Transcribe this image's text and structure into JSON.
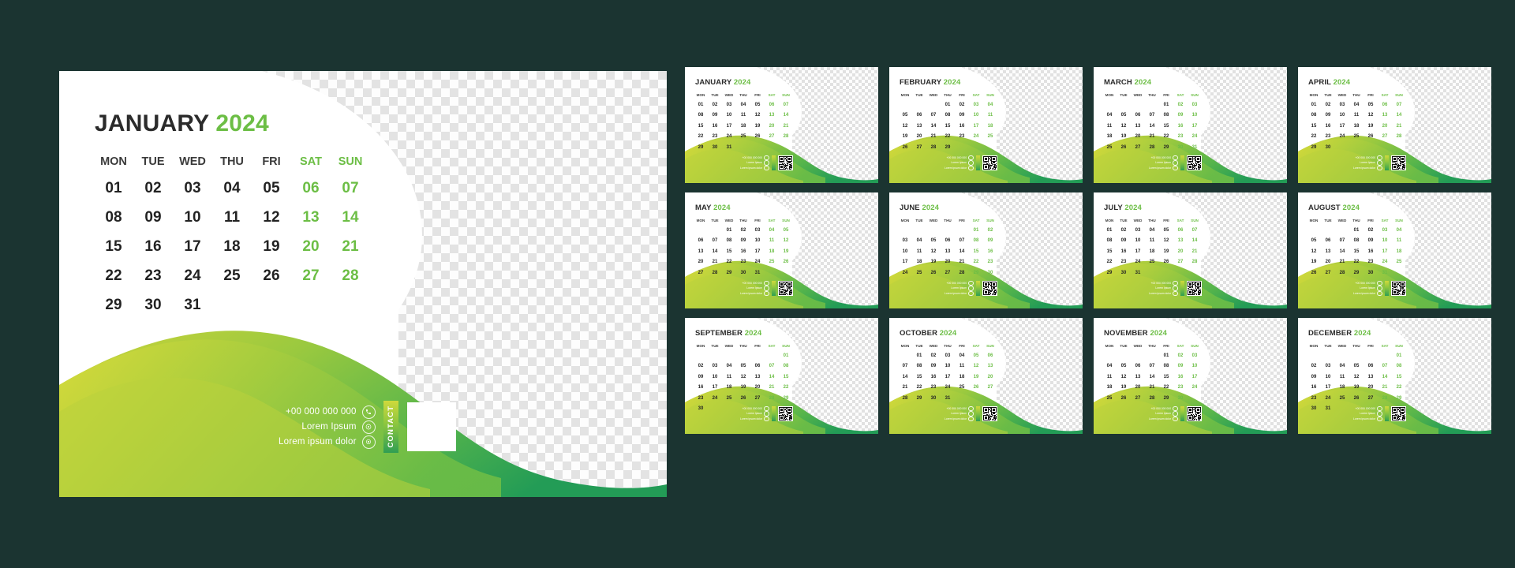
{
  "theme": {
    "background": "#1b3431",
    "accent_green": "#6cbe45",
    "wave_yellow": "#cdd43a",
    "wave_green": "#8cc63f",
    "wave_dark_green": "#2f9e53",
    "text_dark": "#2b2b2b"
  },
  "weekdays": [
    "MON",
    "TUE",
    "WED",
    "THU",
    "FRI",
    "SAT",
    "SUN"
  ],
  "contact": {
    "label": "CONTACT",
    "phone": "+00 000 000 000",
    "email": "Lorem Ipsum",
    "address": "Lorem ipsum dolor",
    "icons": [
      "phone-icon",
      "globe-icon",
      "location-icon"
    ]
  },
  "featured": {
    "month": "JANUARY",
    "year": "2024"
  },
  "months": [
    {
      "name": "JANUARY",
      "year": "2024",
      "lead_blanks": 0,
      "days": 31,
      "weeks": [
        [
          "01",
          "02",
          "03",
          "04",
          "05",
          "06",
          "07"
        ],
        [
          "08",
          "09",
          "10",
          "11",
          "12",
          "13",
          "14"
        ],
        [
          "15",
          "16",
          "17",
          "18",
          "19",
          "20",
          "21"
        ],
        [
          "22",
          "23",
          "24",
          "25",
          "26",
          "27",
          "28"
        ],
        [
          "29",
          "30",
          "31",
          "",
          "",
          "",
          ""
        ]
      ]
    },
    {
      "name": "FEBRUARY",
      "year": "2024",
      "lead_blanks": 3,
      "days": 29,
      "weeks": [
        [
          "",
          "",
          "",
          "01",
          "02",
          "03",
          "04"
        ],
        [
          "05",
          "06",
          "07",
          "08",
          "09",
          "10",
          "11"
        ],
        [
          "12",
          "13",
          "14",
          "15",
          "16",
          "17",
          "18"
        ],
        [
          "19",
          "20",
          "21",
          "22",
          "23",
          "24",
          "25"
        ],
        [
          "26",
          "27",
          "28",
          "29",
          "",
          "",
          ""
        ]
      ]
    },
    {
      "name": "MARCH",
      "year": "2024",
      "lead_blanks": 4,
      "days": 31,
      "weeks": [
        [
          "",
          "",
          "",
          "",
          "01",
          "02",
          "03"
        ],
        [
          "04",
          "05",
          "06",
          "07",
          "08",
          "09",
          "10"
        ],
        [
          "11",
          "12",
          "13",
          "14",
          "15",
          "16",
          "17"
        ],
        [
          "18",
          "19",
          "20",
          "21",
          "22",
          "23",
          "24"
        ],
        [
          "25",
          "26",
          "27",
          "28",
          "29",
          "30",
          "31"
        ]
      ]
    },
    {
      "name": "APRIL",
      "year": "2024",
      "lead_blanks": 0,
      "days": 30,
      "weeks": [
        [
          "01",
          "02",
          "03",
          "04",
          "05",
          "06",
          "07"
        ],
        [
          "08",
          "09",
          "10",
          "11",
          "12",
          "13",
          "14"
        ],
        [
          "15",
          "16",
          "17",
          "18",
          "19",
          "20",
          "21"
        ],
        [
          "22",
          "23",
          "24",
          "25",
          "26",
          "27",
          "28"
        ],
        [
          "29",
          "30",
          "",
          "",
          "",
          "",
          ""
        ]
      ]
    },
    {
      "name": "MAY",
      "year": "2024",
      "lead_blanks": 2,
      "days": 31,
      "weeks": [
        [
          "",
          "",
          "01",
          "02",
          "03",
          "04",
          "05"
        ],
        [
          "06",
          "07",
          "08",
          "09",
          "10",
          "11",
          "12"
        ],
        [
          "13",
          "14",
          "15",
          "16",
          "17",
          "18",
          "19"
        ],
        [
          "20",
          "21",
          "22",
          "23",
          "24",
          "25",
          "26"
        ],
        [
          "27",
          "28",
          "29",
          "30",
          "31",
          "",
          ""
        ]
      ]
    },
    {
      "name": "JUNE",
      "year": "2024",
      "lead_blanks": 5,
      "days": 30,
      "weeks": [
        [
          "",
          "",
          "",
          "",
          "",
          "01",
          "02"
        ],
        [
          "03",
          "04",
          "05",
          "06",
          "07",
          "08",
          "09"
        ],
        [
          "10",
          "11",
          "12",
          "13",
          "14",
          "15",
          "16"
        ],
        [
          "17",
          "18",
          "19",
          "20",
          "21",
          "22",
          "23"
        ],
        [
          "24",
          "25",
          "26",
          "27",
          "28",
          "29",
          "30"
        ]
      ]
    },
    {
      "name": "JULY",
      "year": "2024",
      "lead_blanks": 0,
      "days": 31,
      "weeks": [
        [
          "01",
          "02",
          "03",
          "04",
          "05",
          "06",
          "07"
        ],
        [
          "08",
          "09",
          "10",
          "11",
          "12",
          "13",
          "14"
        ],
        [
          "15",
          "16",
          "17",
          "18",
          "19",
          "20",
          "21"
        ],
        [
          "22",
          "23",
          "24",
          "25",
          "26",
          "27",
          "28"
        ],
        [
          "29",
          "30",
          "31",
          "",
          "",
          "",
          ""
        ]
      ]
    },
    {
      "name": "AUGUST",
      "year": "2024",
      "lead_blanks": 3,
      "days": 31,
      "weeks": [
        [
          "",
          "",
          "",
          "01",
          "02",
          "03",
          "04"
        ],
        [
          "05",
          "06",
          "07",
          "08",
          "09",
          "10",
          "11"
        ],
        [
          "12",
          "13",
          "14",
          "15",
          "16",
          "17",
          "18"
        ],
        [
          "19",
          "20",
          "21",
          "22",
          "23",
          "24",
          "25"
        ],
        [
          "26",
          "27",
          "28",
          "29",
          "30",
          "31",
          ""
        ]
      ]
    },
    {
      "name": "SEPTEMBER",
      "year": "2024",
      "lead_blanks": 6,
      "days": 30,
      "weeks": [
        [
          "",
          "",
          "",
          "",
          "",
          "",
          "01"
        ],
        [
          "02",
          "03",
          "04",
          "05",
          "06",
          "07",
          "08"
        ],
        [
          "09",
          "10",
          "11",
          "12",
          "13",
          "14",
          "15"
        ],
        [
          "16",
          "17",
          "18",
          "19",
          "20",
          "21",
          "22"
        ],
        [
          "23",
          "24",
          "25",
          "26",
          "27",
          "28",
          "29"
        ],
        [
          "30",
          "",
          "",
          "",
          "",
          "",
          ""
        ]
      ]
    },
    {
      "name": "OCTOBER",
      "year": "2024",
      "lead_blanks": 1,
      "days": 31,
      "weeks": [
        [
          "",
          "01",
          "02",
          "03",
          "04",
          "05",
          "06"
        ],
        [
          "07",
          "08",
          "09",
          "10",
          "11",
          "12",
          "13"
        ],
        [
          "14",
          "15",
          "16",
          "17",
          "18",
          "19",
          "20"
        ],
        [
          "21",
          "22",
          "23",
          "24",
          "25",
          "26",
          "27"
        ],
        [
          "28",
          "29",
          "30",
          "31",
          "",
          "",
          ""
        ]
      ]
    },
    {
      "name": "NOVEMBER",
      "year": "2024",
      "lead_blanks": 4,
      "days": 30,
      "weeks": [
        [
          "",
          "",
          "",
          "",
          "01",
          "02",
          "03"
        ],
        [
          "04",
          "05",
          "06",
          "07",
          "08",
          "09",
          "10"
        ],
        [
          "11",
          "12",
          "13",
          "14",
          "15",
          "16",
          "17"
        ],
        [
          "18",
          "19",
          "20",
          "21",
          "22",
          "23",
          "24"
        ],
        [
          "25",
          "26",
          "27",
          "28",
          "29",
          "30",
          ""
        ]
      ]
    },
    {
      "name": "DECEMBER",
      "year": "2024",
      "lead_blanks": 6,
      "days": 31,
      "weeks": [
        [
          "",
          "",
          "",
          "",
          "",
          "",
          "01"
        ],
        [
          "02",
          "03",
          "04",
          "05",
          "06",
          "07",
          "08"
        ],
        [
          "09",
          "10",
          "11",
          "12",
          "13",
          "14",
          "15"
        ],
        [
          "16",
          "17",
          "18",
          "19",
          "20",
          "21",
          "22"
        ],
        [
          "23",
          "24",
          "25",
          "26",
          "27",
          "28",
          "29"
        ],
        [
          "30",
          "31",
          "",
          "",
          "",
          "",
          ""
        ]
      ]
    }
  ]
}
